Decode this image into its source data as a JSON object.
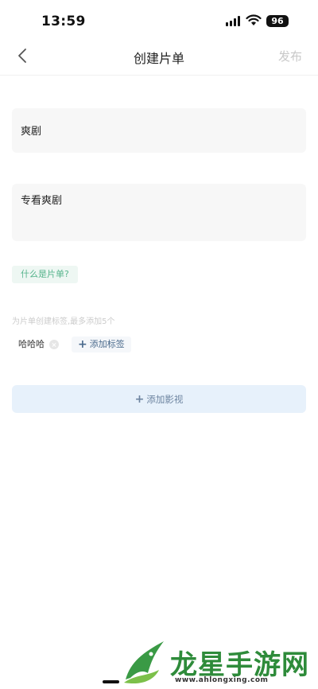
{
  "status_bar": {
    "time": "13:59",
    "battery": "96"
  },
  "nav": {
    "title": "创建片单",
    "publish_label": "发布"
  },
  "form": {
    "title_value": "爽剧",
    "description_value": "专看爽剧",
    "help_link": "什么是片单?",
    "tag_hint": "为片单创建标签,最多添加5个",
    "tags": [
      "哈哈哈"
    ],
    "add_tag_label": "添加标签",
    "add_media_label": "添加影视"
  },
  "watermark": {
    "title": "龙星手游网",
    "url": "www.ahlongxing.com"
  },
  "colors": {
    "accent_green": "#56b48c",
    "add_media_bg": "#e7f1fb",
    "publish_disabled": "#c8c8c8"
  }
}
